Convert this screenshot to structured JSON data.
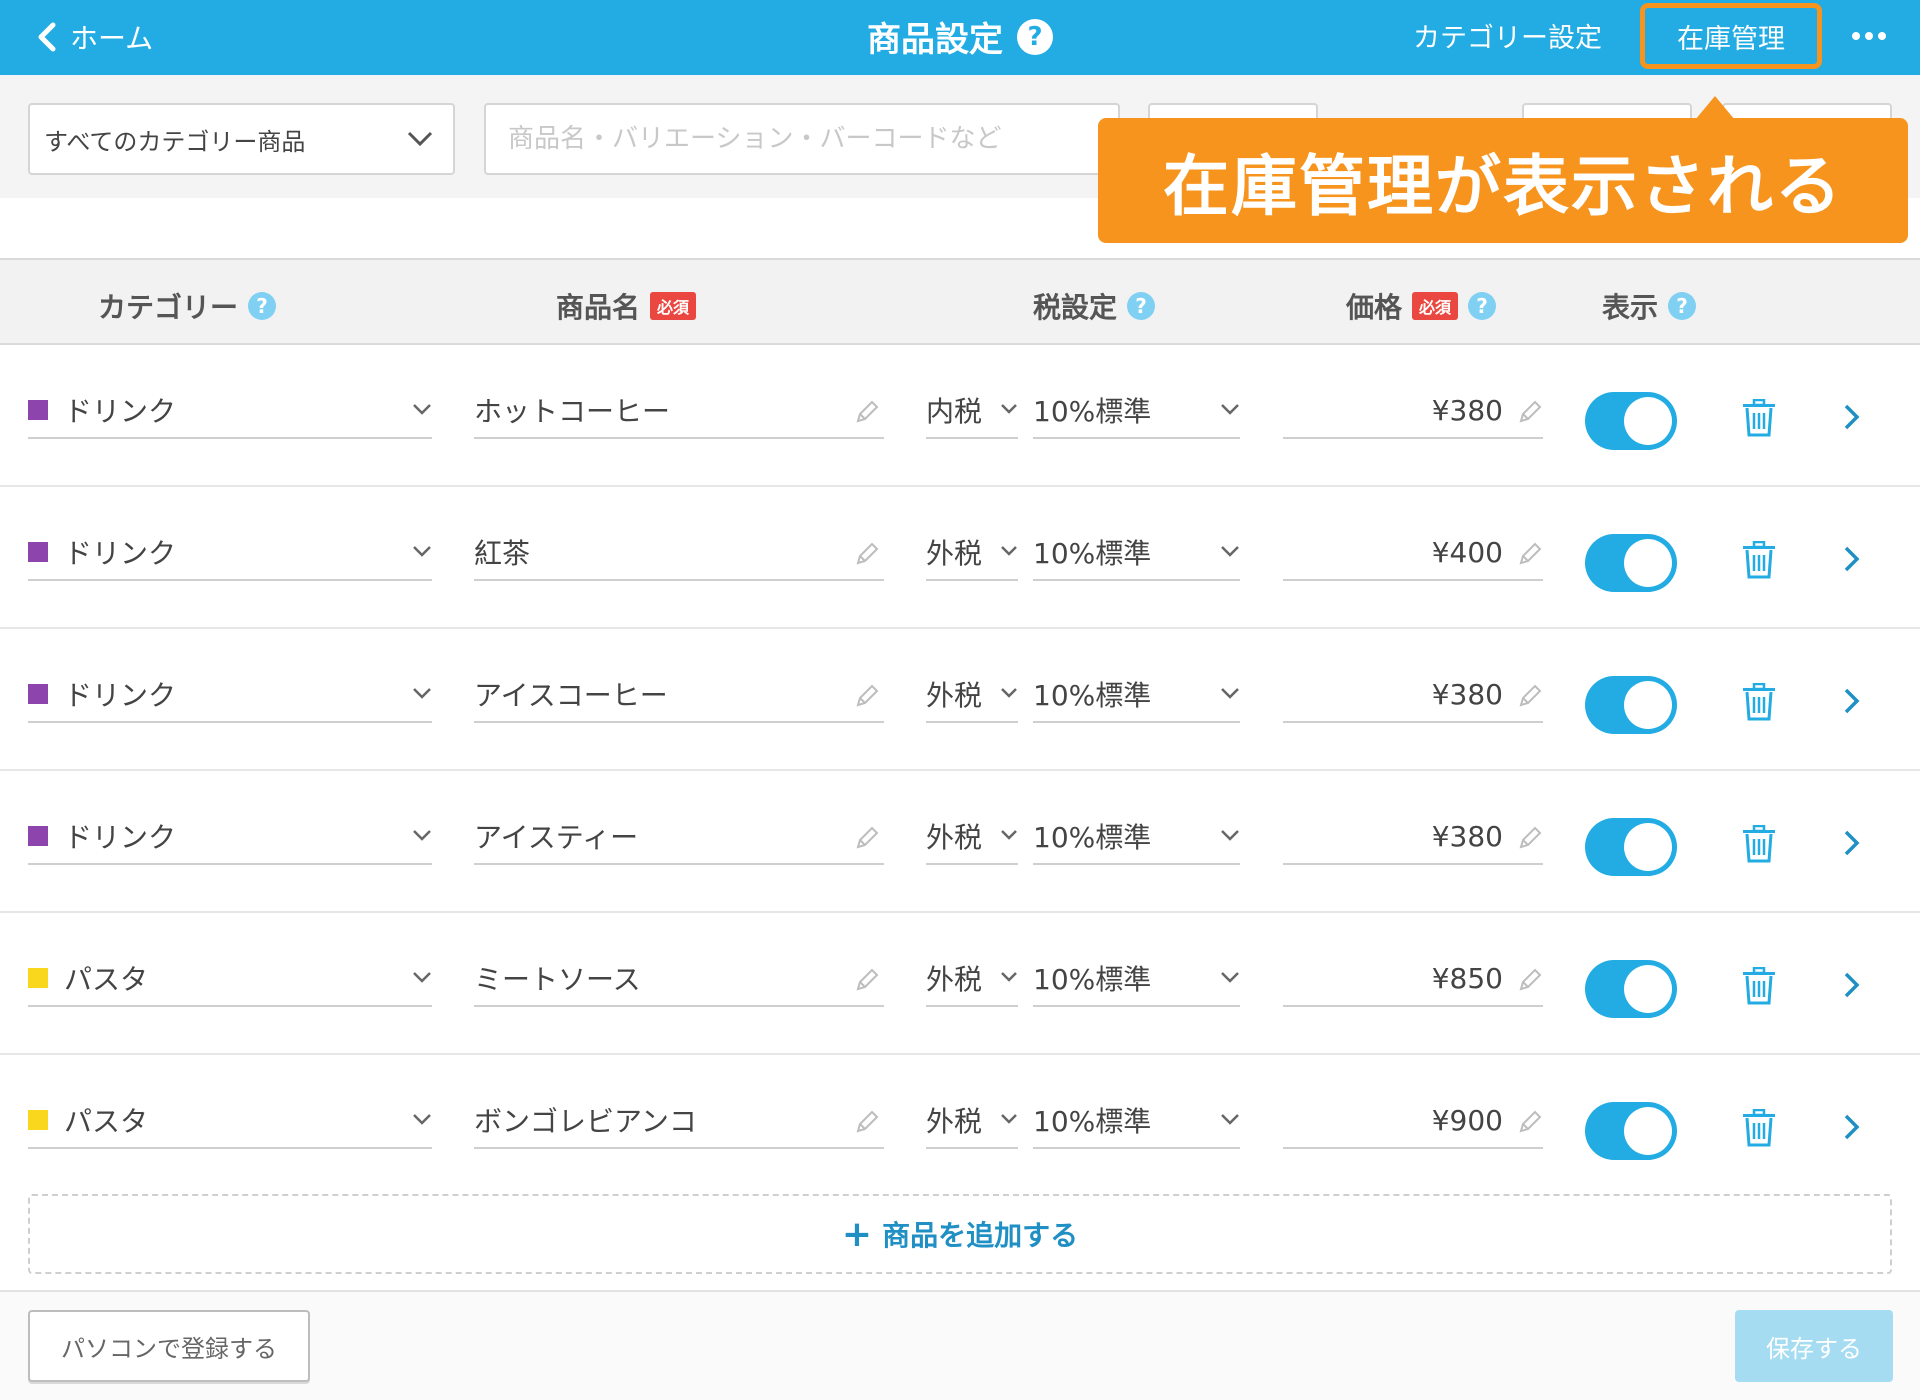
{
  "header": {
    "back_label": "ホーム",
    "title": "商品設定",
    "help": "?",
    "category_link": "カテゴリー設定",
    "stock_link": "在庫管理",
    "more_icon": "more-horizontal-icon"
  },
  "filter": {
    "category_select": "すべてのカテゴリー商品",
    "search_placeholder": "商品名・バリエーション・バーコードなど"
  },
  "callout": {
    "text": "在庫管理が表示される"
  },
  "table": {
    "headers": {
      "category": "カテゴリー",
      "name": "商品名",
      "required": "必須",
      "tax": "税設定",
      "price": "価格",
      "display": "表示",
      "help": "?"
    },
    "rows": [
      {
        "category": "ドリンク",
        "category_color": "#8e44ad",
        "name": "ホットコーヒー",
        "tax_type": "内税",
        "tax_rate": "10%標準",
        "price": "¥380",
        "visible": true
      },
      {
        "category": "ドリンク",
        "category_color": "#8e44ad",
        "name": "紅茶",
        "tax_type": "外税",
        "tax_rate": "10%標準",
        "price": "¥400",
        "visible": true
      },
      {
        "category": "ドリンク",
        "category_color": "#8e44ad",
        "name": "アイスコーヒー",
        "tax_type": "外税",
        "tax_rate": "10%標準",
        "price": "¥380",
        "visible": true
      },
      {
        "category": "ドリンク",
        "category_color": "#8e44ad",
        "name": "アイスティー",
        "tax_type": "外税",
        "tax_rate": "10%標準",
        "price": "¥380",
        "visible": true
      },
      {
        "category": "パスタ",
        "category_color": "#f9d71c",
        "name": "ミートソース",
        "tax_type": "外税",
        "tax_rate": "10%標準",
        "price": "¥850",
        "visible": true
      },
      {
        "category": "パスタ",
        "category_color": "#f9d71c",
        "name": "ボンゴレビアンコ",
        "tax_type": "外税",
        "tax_rate": "10%標準",
        "price": "¥900",
        "visible": true
      }
    ]
  },
  "add_product": {
    "plus": "+",
    "label": "商品を追加する"
  },
  "footer": {
    "pc_register": "パソコンで登録する",
    "save": "保存する"
  },
  "colors": {
    "accent": "#22ace3",
    "callout": "#f7941d",
    "required_badge": "#e9473f"
  }
}
